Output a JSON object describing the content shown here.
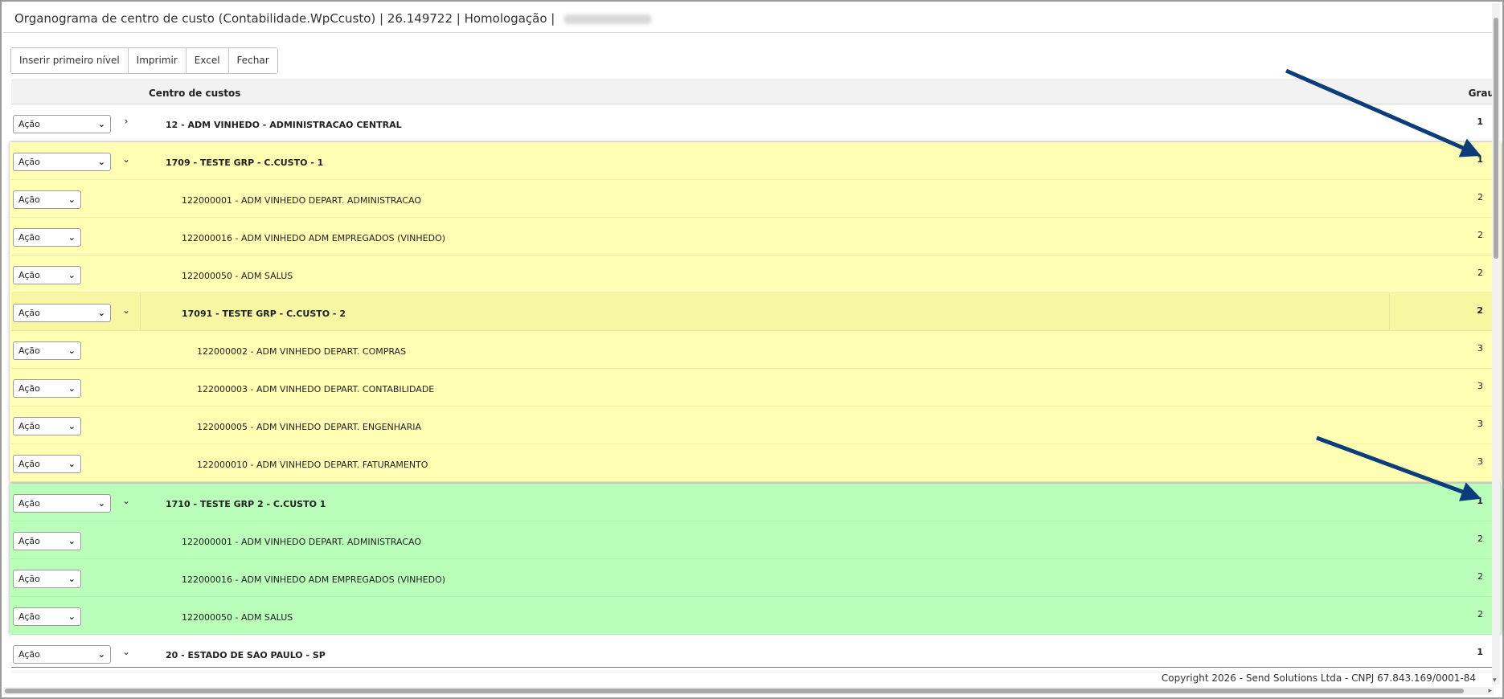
{
  "window": {
    "title": "Organograma de centro de custo (Contabilidade.WpCcusto) | 26.149722 | Homologação |"
  },
  "toolbar": {
    "buttons": [
      "Inserir primeiro nível",
      "Imprimir",
      "Excel",
      "Fechar"
    ]
  },
  "grid": {
    "headers": {
      "name": "Centro de custos",
      "grau": "Grau"
    },
    "action_label": "Ação",
    "rows": [
      {
        "name": "12 - ADM VINHEDO - ADMINISTRACAO CENTRAL",
        "grau": "1",
        "toggle": "›"
      },
      {
        "name": "1709 - TESTE GRP - C.CUSTO - 1",
        "grau": "1",
        "toggle": "⌄"
      },
      {
        "name": "122000001 - ADM VINHEDO DEPART. ADMINISTRACAO",
        "grau": "2"
      },
      {
        "name": "122000016 - ADM VINHEDO ADM EMPREGADOS (VINHEDO)",
        "grau": "2"
      },
      {
        "name": "122000050 - ADM SALUS",
        "grau": "2"
      },
      {
        "name": "17091 - TESTE GRP - C.CUSTO - 2",
        "grau": "2",
        "toggle": "⌄"
      },
      {
        "name": "122000002 - ADM VINHEDO DEPART. COMPRAS",
        "grau": "3"
      },
      {
        "name": "122000003 - ADM VINHEDO DEPART. CONTABILIDADE",
        "grau": "3"
      },
      {
        "name": "122000005 - ADM VINHEDO DEPART. ENGENHARIA",
        "grau": "3"
      },
      {
        "name": "122000010 - ADM VINHEDO DEPART. FATURAMENTO",
        "grau": "3"
      },
      {
        "name": "1710 - TESTE GRP 2 - C.CUSTO 1",
        "grau": "1",
        "toggle": "⌄"
      },
      {
        "name": "122000001 - ADM VINHEDO DEPART. ADMINISTRACAO",
        "grau": "2"
      },
      {
        "name": "122000016 - ADM VINHEDO ADM EMPREGADOS (VINHEDO)",
        "grau": "2"
      },
      {
        "name": "122000050 - ADM SALUS",
        "grau": "2"
      },
      {
        "name": "20 - ESTADO DE SAO PAULO - SP",
        "grau": "1",
        "toggle": "⌄"
      }
    ]
  },
  "footer": {
    "copyright": "Copyright 2026 - Send Solutions Ltda - CNPJ 67.843.169/0001-84"
  },
  "colors": {
    "highlight_yellow": "#ffffb3",
    "highlight_green": "#b9ffb9",
    "annotation_arrow": "#0b3d7a"
  },
  "scrollbars": {
    "vertical_arrow_down": "▾",
    "horizontal_arrow_right": "▸"
  }
}
